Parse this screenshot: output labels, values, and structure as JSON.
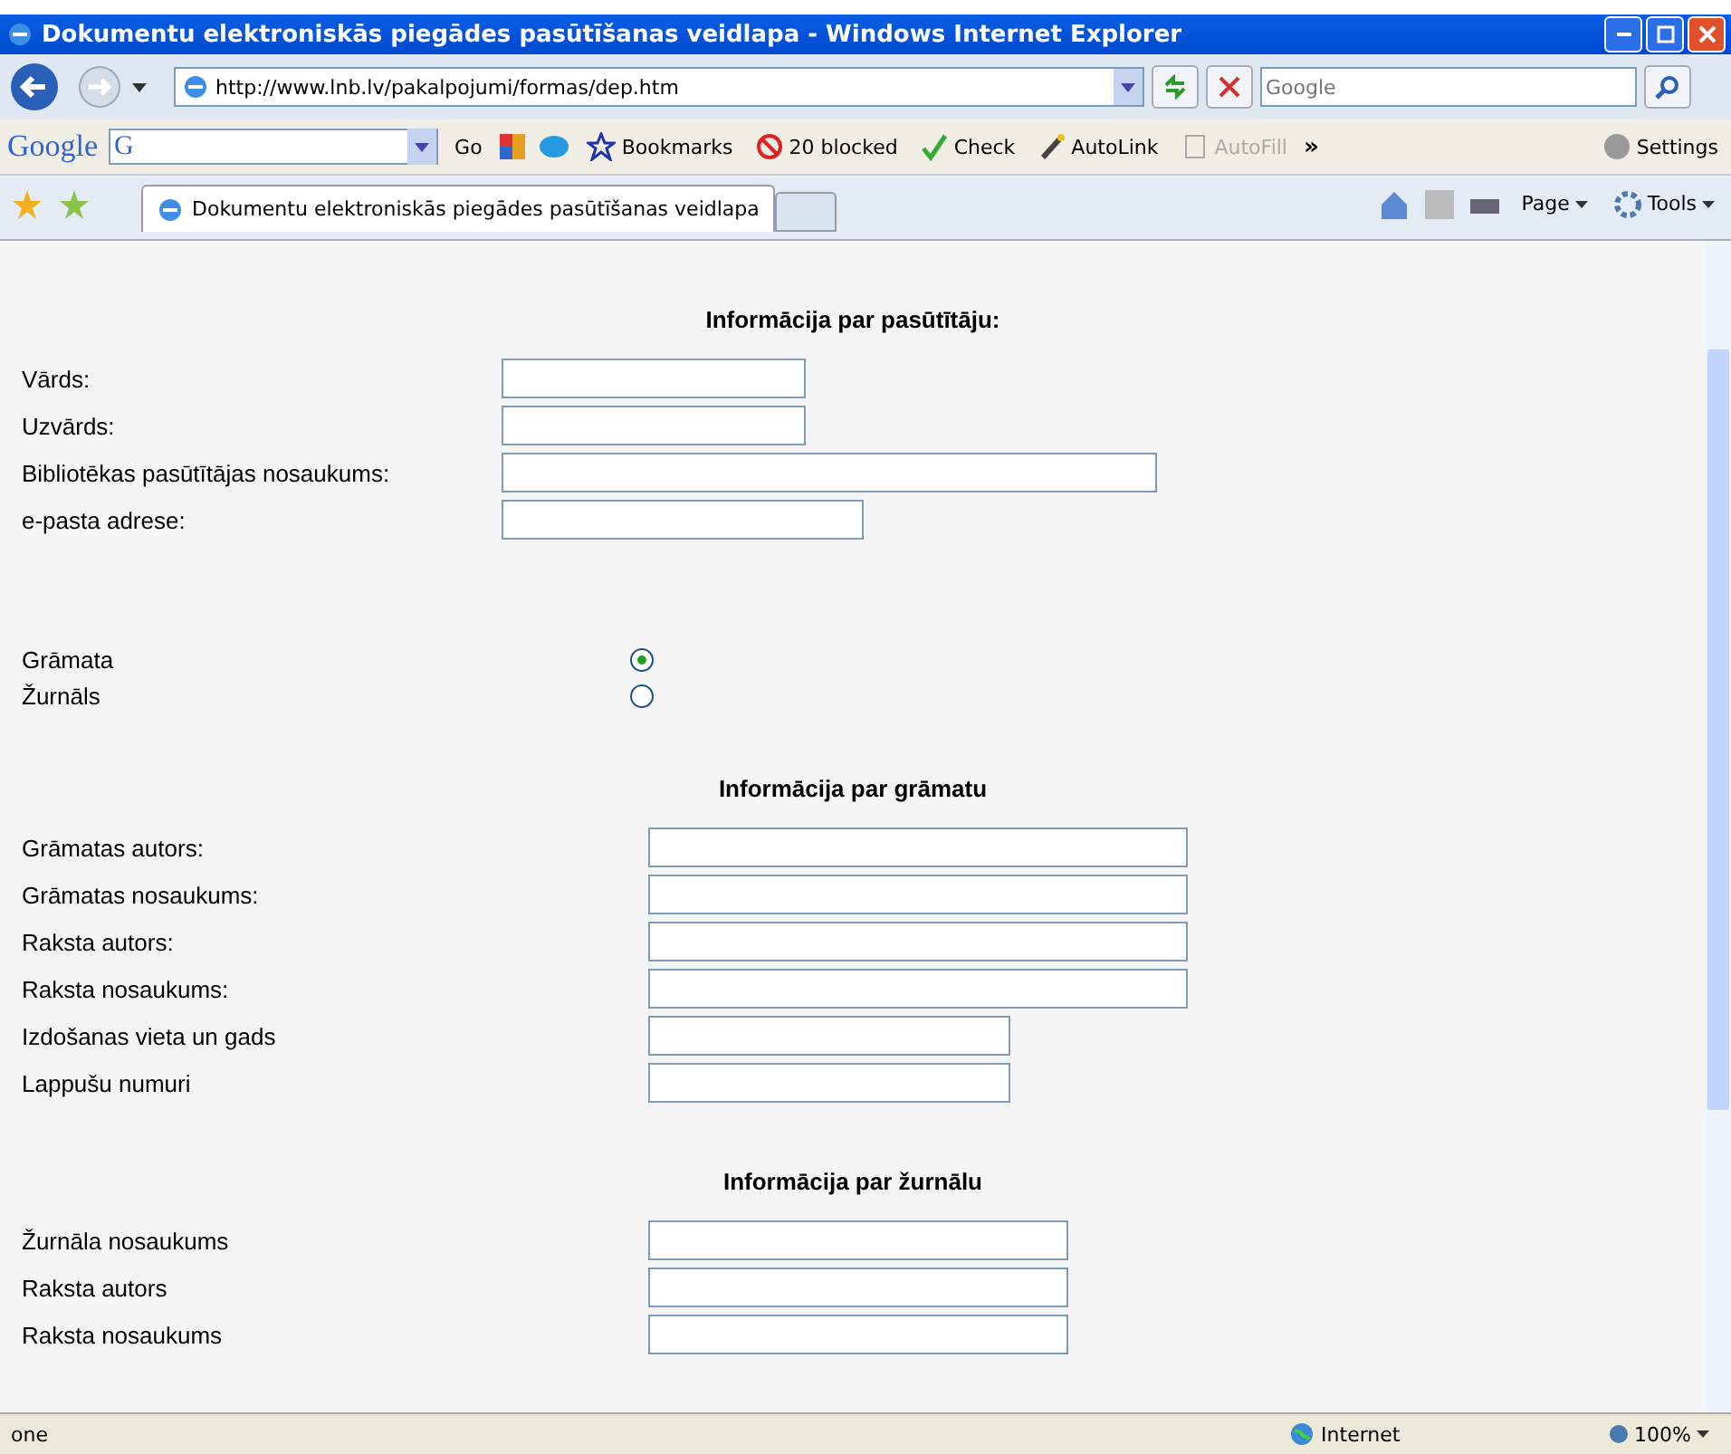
{
  "window": {
    "title": "Dokumentu elektroniskās piegādes pasūtīšanas veidlapa - Windows Internet Explorer"
  },
  "address_bar": {
    "url": "http://www.lnb.lv/pakalpojumi/formas/dep.htm",
    "search_placeholder": "Google"
  },
  "google_toolbar": {
    "logo": "Google",
    "search_logo": "G",
    "go": "Go",
    "items": [
      {
        "label": "Bookmarks",
        "kind": "bookmarks",
        "disabled": false
      },
      {
        "label": "20 blocked",
        "kind": "blocked",
        "disabled": false
      },
      {
        "label": "Check",
        "kind": "check",
        "disabled": false
      },
      {
        "label": "AutoLink",
        "kind": "autolink",
        "disabled": false
      },
      {
        "label": "AutoFill",
        "kind": "autofill",
        "disabled": true
      }
    ],
    "more": "»",
    "settings": "Settings"
  },
  "tabs": [
    {
      "label": "Dokumentu elektroniskās piegādes pasūtīšanas veidlapa",
      "selected": true
    }
  ],
  "command_bar": {
    "page": "Page",
    "tools": "Tools"
  },
  "sections": [
    {
      "heading": "Informācija par pasūtītāju:",
      "fields": [
        {
          "label": "Vārds:"
        },
        {
          "label": "Uzvārds:"
        },
        {
          "label": "Bibliotēkas pasūtītājas nosaukums:"
        },
        {
          "label": "e-pasta adrese:"
        }
      ]
    },
    {
      "radios": [
        {
          "label": "Grāmata",
          "selected": true
        },
        {
          "label": "Žurnāls",
          "selected": false
        }
      ]
    },
    {
      "heading": "Informācija par grāmatu",
      "fields": [
        {
          "label": "Grāmatas autors:"
        },
        {
          "label": "Grāmatas nosaukums:"
        },
        {
          "label": "Raksta autors:"
        },
        {
          "label": "Raksta nosaukums:"
        },
        {
          "label": "Izdošanas vieta un gads"
        },
        {
          "label": "Lappušu numuri"
        }
      ]
    },
    {
      "heading": "Informācija par žurnālu",
      "fields": [
        {
          "label": "Žurnāla nosaukums"
        },
        {
          "label": "Raksta autors"
        },
        {
          "label": "Raksta nosaukums"
        }
      ]
    }
  ],
  "status_bar": {
    "text": "one",
    "zone": "Internet",
    "zoom": "100%"
  }
}
